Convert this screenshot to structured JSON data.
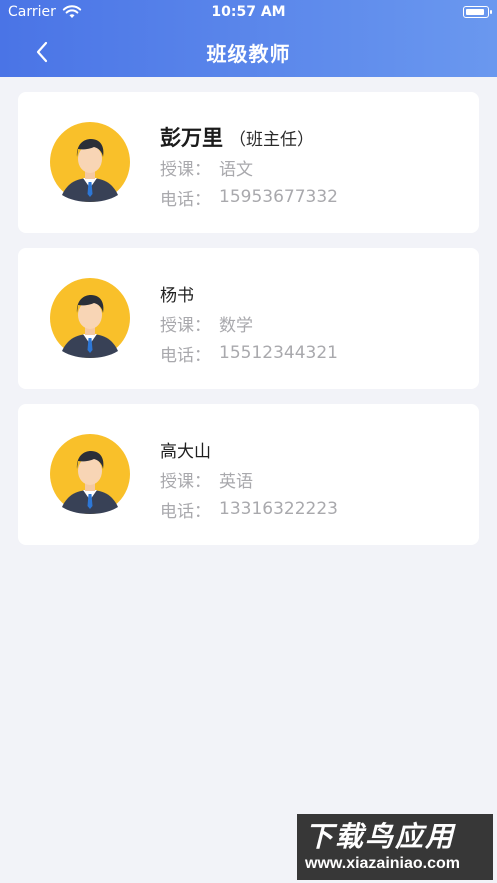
{
  "status_bar": {
    "carrier": "Carrier",
    "time": "10:57 AM"
  },
  "nav": {
    "title": "班级教师",
    "back_icon": "chevron-left-icon"
  },
  "teachers": [
    {
      "name": "彭万里",
      "role": "（班主任）",
      "subject_label": "授课：",
      "subject": "语文",
      "phone_label": "电话：",
      "phone": "15953677332"
    },
    {
      "name": "杨书",
      "role": "",
      "subject_label": "授课：",
      "subject": "数学",
      "phone_label": "电话：",
      "phone": "15512344321"
    },
    {
      "name": "高大山",
      "role": "",
      "subject_label": "授课：",
      "subject": "英语",
      "phone_label": "电话：",
      "phone": "13316322223"
    }
  ],
  "watermark": {
    "title": "下载鸟应用",
    "url": "www.xiazainiao.com"
  },
  "colors": {
    "nav_gradient_start": "#4a74e6",
    "nav_gradient_end": "#6a98ef",
    "background": "#f2f3f8",
    "card": "#ffffff",
    "avatar_bg": "#f9c02a",
    "muted_text": "#a9a9ad"
  }
}
